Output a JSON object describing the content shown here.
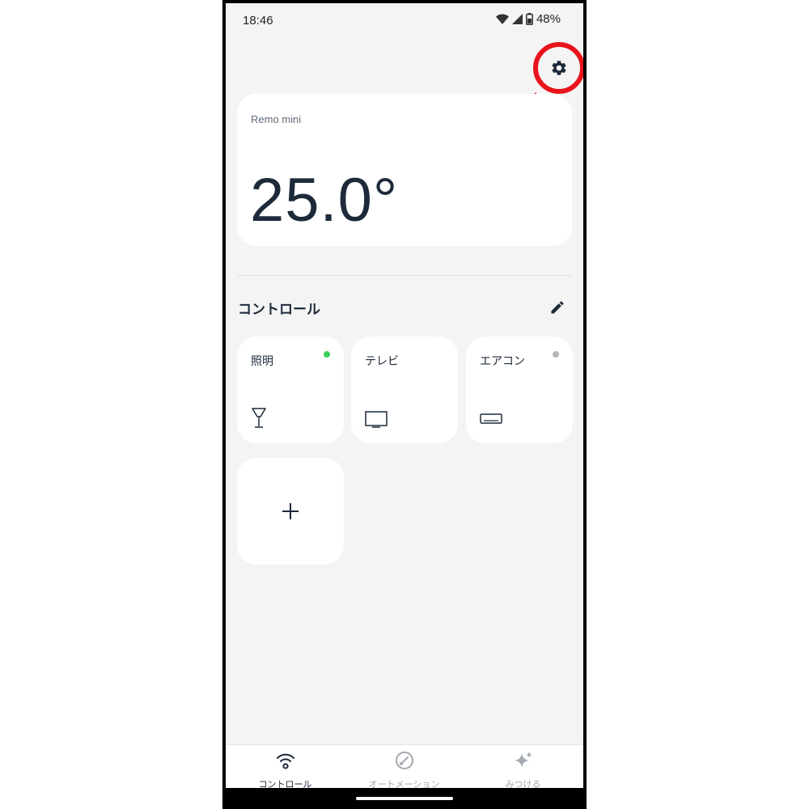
{
  "status_bar": {
    "time": "18:46",
    "battery": "48%",
    "icons": [
      "wifi-icon",
      "cell-signal-icon",
      "battery-icon"
    ]
  },
  "header": {
    "settings_icon": "gear-icon",
    "highlight_color": "#e8141a"
  },
  "remo_card": {
    "device_name": "Remo mini",
    "temperature": "25.0°"
  },
  "controls": {
    "section_title": "コントロール",
    "edit_icon": "pencil-icon",
    "tiles": [
      {
        "label": "照明",
        "icon": "lamp-icon",
        "status": "on",
        "status_color": "#3ccf5a"
      },
      {
        "label": "テレビ",
        "icon": "tv-icon",
        "status": "none",
        "status_color": ""
      },
      {
        "label": "エアコン",
        "icon": "air-conditioner-icon",
        "status": "off",
        "status_color": "#b5b5b5"
      }
    ],
    "add_icon": "plus-icon"
  },
  "bottom_nav": {
    "items": [
      {
        "label": "コントロール",
        "icon": "wifi-signal-icon",
        "active": true
      },
      {
        "label": "オートメーション",
        "icon": "gauge-icon",
        "active": false
      },
      {
        "label": "みつける",
        "icon": "sparkle-icon",
        "active": false
      }
    ]
  },
  "colors": {
    "background": "#f4f4f4",
    "card": "#ffffff",
    "text": "#1d2a3a",
    "inactive_text": "#a3a9b0"
  }
}
